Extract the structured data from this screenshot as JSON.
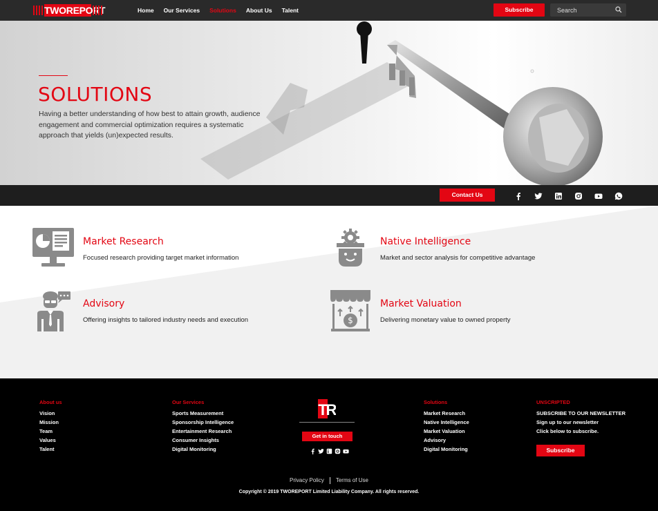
{
  "brand": {
    "logo_text": "TWOREPORT",
    "accent": "#e30613"
  },
  "nav": {
    "links": [
      "Home",
      "Our Services",
      "Solutions",
      "About Us",
      "Talent"
    ],
    "active": "Solutions",
    "subscribe_label": "Subscribe",
    "search_placeholder": "Search"
  },
  "hero": {
    "title": "SOLUTIONS",
    "text": "Having a better understanding of how best to attain growth, audience engagement and commercial optimization requires a systematic approach that yields (un)expected results."
  },
  "bar": {
    "contact_label": "Contact Us",
    "social_icons": [
      "facebook-icon",
      "twitter-icon",
      "linkedin-icon",
      "instagram-icon",
      "youtube-icon",
      "whatsapp-icon"
    ]
  },
  "services": [
    {
      "title": "Market Research",
      "desc": "Focused research providing target market information",
      "icon": "monitor-chart-icon"
    },
    {
      "title": "Native Intelligence",
      "desc": "Market and sector analysis for competitive advantage",
      "icon": "head-gear-icon"
    },
    {
      "title": "Advisory",
      "desc": "Offering insights to tailored industry needs and execution",
      "icon": "advisor-icon"
    },
    {
      "title": "Market Valuation",
      "desc": "Delivering monetary value to owned property",
      "icon": "storefront-value-icon"
    }
  ],
  "footer": {
    "about": {
      "heading": "About us",
      "items": [
        "Vision",
        "Mission",
        "Team",
        "Values",
        "Talent"
      ]
    },
    "services": {
      "heading": "Our Services",
      "items": [
        "Sports Measurement",
        "Sponsorship Intelligence",
        "Entertainment Research",
        "Consumer Insights",
        "Digital Monitoring"
      ]
    },
    "center": {
      "logo_text": "TR",
      "button_label": "Get in touch"
    },
    "solutions": {
      "heading": "Solutions",
      "items": [
        "Market Research",
        "Native Intelligence",
        "Market Valuation",
        "Advisory",
        "Digital Monitoring"
      ]
    },
    "newsletter": {
      "heading": "UNSCRIPTED",
      "items": [
        "SUBSCRIBE TO OUR NEWSLETTER",
        "Sign up to our newsletter",
        "Click below to subscribe."
      ],
      "button_label": "Subscribe"
    },
    "privacy": "Privacy Policy",
    "terms": "Terms of Use",
    "copyright": "Copyright © 2019 TWOREPORT Limited Liability Company. All rights reserved."
  }
}
